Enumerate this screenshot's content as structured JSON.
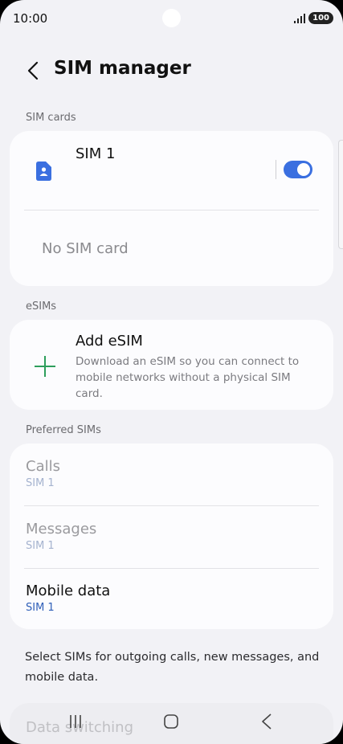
{
  "status_bar": {
    "time": "10:00",
    "battery": "100"
  },
  "header": {
    "title": "SIM manager"
  },
  "sections": {
    "sim_cards": "SIM cards",
    "esims": "eSIMs",
    "preferred": "Preferred SIMs"
  },
  "sim_card": {
    "name": "SIM 1",
    "enabled": true,
    "empty_slot": "No SIM card"
  },
  "esim": {
    "title": "Add eSIM",
    "description": "Download an eSIM so you can connect to mobile networks without a physical SIM card."
  },
  "preferred": {
    "calls": {
      "title": "Calls",
      "value": "SIM 1"
    },
    "messages": {
      "title": "Messages",
      "value": "SIM 1"
    },
    "mobile_data": {
      "title": "Mobile data",
      "value": "SIM 1"
    }
  },
  "footnote": "Select SIMs for outgoing calls, new messages, and mobile data.",
  "data_switching": "Data switching",
  "icons": {
    "back": "back-arrow-icon",
    "sim": "sim-card-icon",
    "plus": "plus-icon",
    "nav_recents": "recents-icon",
    "nav_home": "home-icon",
    "nav_back": "nav-back-icon"
  },
  "colors": {
    "accent": "#3a6fe0",
    "plus": "#2e9e5c",
    "sub_active": "#2f5fb8"
  }
}
